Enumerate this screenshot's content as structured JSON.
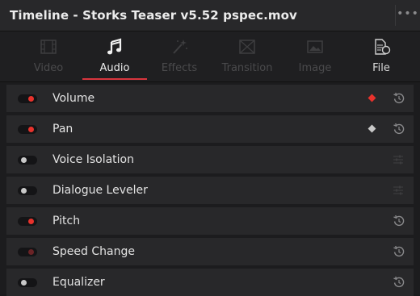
{
  "window": {
    "title": "Timeline - Storks Teaser v5.52 pspec.mov",
    "menu_icon": "ellipsis-icon"
  },
  "tabs": [
    {
      "label": "Video",
      "icon": "video-filmstrip-icon",
      "state": "disabled"
    },
    {
      "label": "Audio",
      "icon": "music-note-icon",
      "state": "active"
    },
    {
      "label": "Effects",
      "icon": "magic-wand-icon",
      "state": "disabled"
    },
    {
      "label": "Transition",
      "icon": "transition-icon",
      "state": "disabled"
    },
    {
      "label": "Image",
      "icon": "image-icon",
      "state": "disabled"
    },
    {
      "label": "File",
      "icon": "file-info-icon",
      "state": "enabled"
    }
  ],
  "rows": [
    {
      "label": "Volume",
      "toggle": "on",
      "keyframe": "red",
      "right_icon": "reset-icon"
    },
    {
      "label": "Pan",
      "toggle": "on",
      "keyframe": "grey",
      "right_icon": "reset-icon"
    },
    {
      "label": "Voice Isolation",
      "toggle": "off",
      "keyframe": "none",
      "right_icon": "adjust-icon"
    },
    {
      "label": "Dialogue Leveler",
      "toggle": "off",
      "keyframe": "none",
      "right_icon": "adjust-icon"
    },
    {
      "label": "Pitch",
      "toggle": "on",
      "keyframe": "none",
      "right_icon": "reset-icon"
    },
    {
      "label": "Speed Change",
      "toggle": "dim",
      "keyframe": "none",
      "right_icon": "reset-icon"
    },
    {
      "label": "Equalizer",
      "toggle": "off",
      "keyframe": "none",
      "right_icon": "reset-icon"
    }
  ],
  "colors": {
    "accent_red": "#e8322c",
    "keyframe_red": "#e8322c",
    "keyframe_grey": "#c8c8c8",
    "panel_bg": "#1c1c1e",
    "row_bg": "#28282a"
  }
}
